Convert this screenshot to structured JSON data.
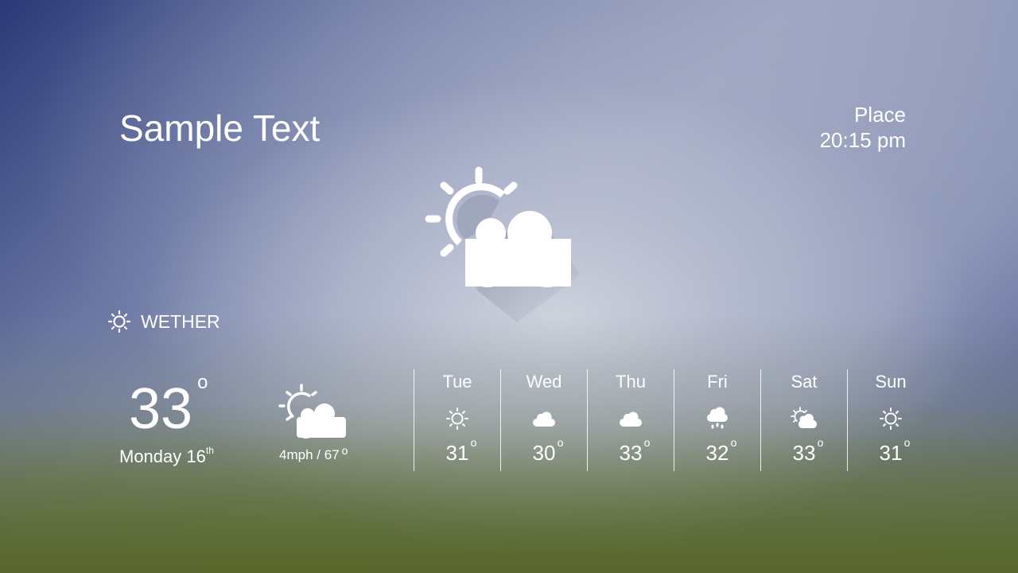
{
  "header": {
    "title": "Sample Text",
    "place": "Place",
    "time": "20:15 pm"
  },
  "hero": {
    "icon": "partly-cloudy-icon"
  },
  "section": {
    "icon": "sun-icon",
    "label": "WETHER"
  },
  "current": {
    "temperature": "33",
    "degree_symbol": "o",
    "day": "Monday 16",
    "day_suffix": "th",
    "icon": "partly-cloudy-icon",
    "wind_humidity": "4mph / 67",
    "wind_degree_symbol": "o"
  },
  "forecast": [
    {
      "day": "Tue",
      "icon": "sun-icon",
      "temp": "31",
      "deg": "o"
    },
    {
      "day": "Wed",
      "icon": "cloud-icon",
      "temp": "30",
      "deg": "o"
    },
    {
      "day": "Thu",
      "icon": "cloud-icon",
      "temp": "33",
      "deg": "o"
    },
    {
      "day": "Fri",
      "icon": "rain-cloud-icon",
      "temp": "32",
      "deg": "o"
    },
    {
      "day": "Sat",
      "icon": "partly-cloudy-icon",
      "temp": "33",
      "deg": "o"
    },
    {
      "day": "Sun",
      "icon": "sun-icon",
      "temp": "31",
      "deg": "o"
    }
  ]
}
